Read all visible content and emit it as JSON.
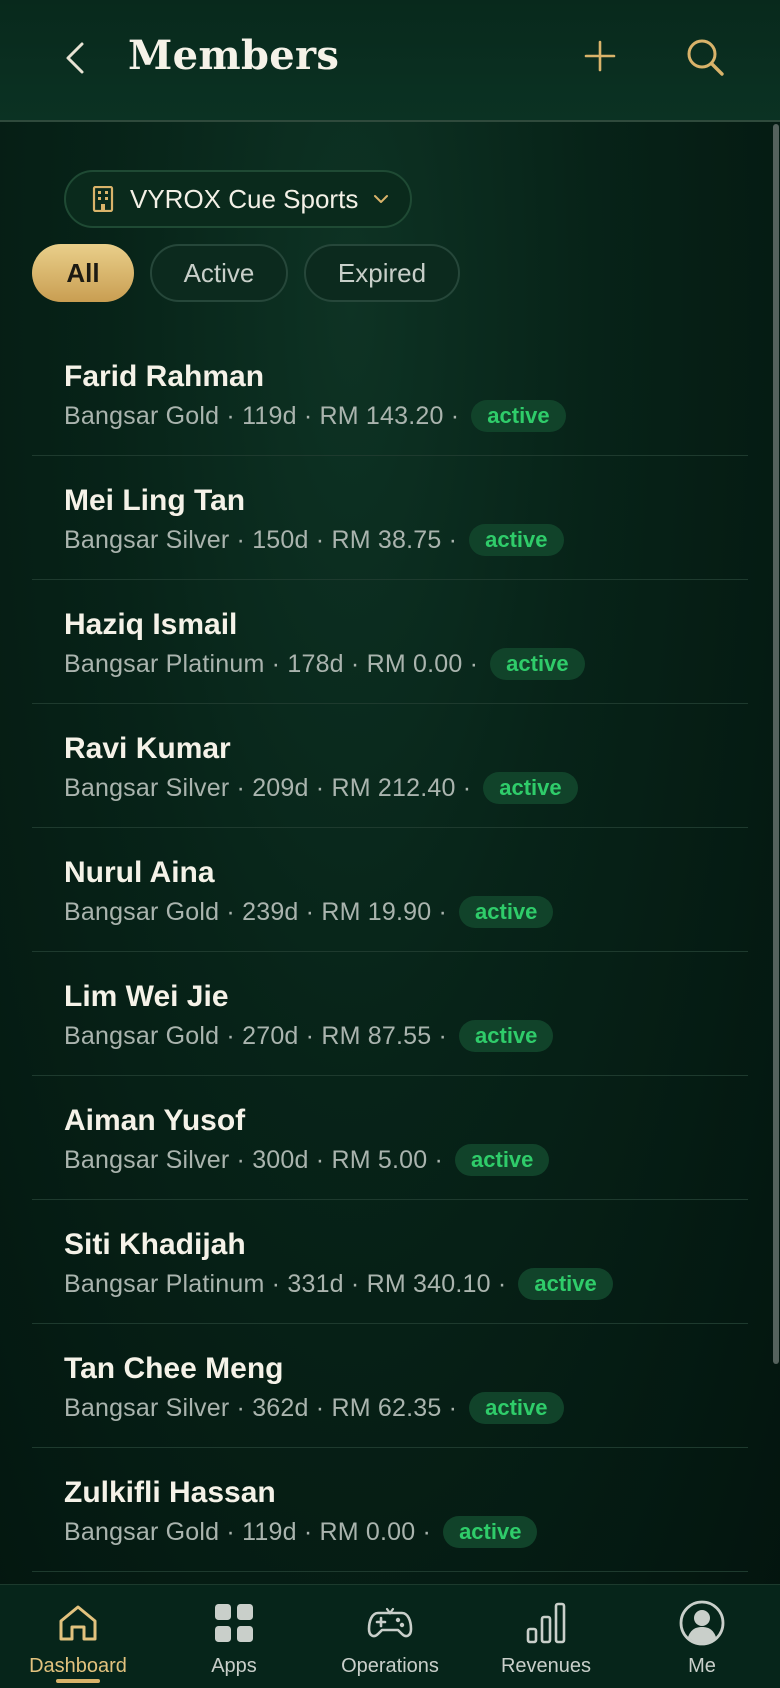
{
  "header": {
    "title": "Members",
    "back_icon": "chevron-left-icon",
    "add_icon": "plus-icon",
    "search_icon": "search-icon"
  },
  "venue": {
    "icon": "building-icon",
    "label": "VYROX Cue Sports",
    "chevron_icon": "chevron-down-icon"
  },
  "filters": [
    {
      "label": "All",
      "selected": true
    },
    {
      "label": "Active",
      "selected": false
    },
    {
      "label": "Expired",
      "selected": false
    }
  ],
  "members": [
    {
      "name": "Farid Rahman",
      "plan": "Bangsar Gold",
      "days": "119d",
      "balance": "RM 143.20",
      "status": "active"
    },
    {
      "name": "Mei Ling Tan",
      "plan": "Bangsar Silver",
      "days": "150d",
      "balance": "RM 38.75",
      "status": "active"
    },
    {
      "name": "Haziq Ismail",
      "plan": "Bangsar Platinum",
      "days": "178d",
      "balance": "RM 0.00",
      "status": "active"
    },
    {
      "name": "Ravi Kumar",
      "plan": "Bangsar Silver",
      "days": "209d",
      "balance": "RM 212.40",
      "status": "active"
    },
    {
      "name": "Nurul Aina",
      "plan": "Bangsar Gold",
      "days": "239d",
      "balance": "RM 19.90",
      "status": "active"
    },
    {
      "name": "Lim Wei Jie",
      "plan": "Bangsar Gold",
      "days": "270d",
      "balance": "RM 87.55",
      "status": "active"
    },
    {
      "name": "Aiman Yusof",
      "plan": "Bangsar Silver",
      "days": "300d",
      "balance": "RM 5.00",
      "status": "active"
    },
    {
      "name": "Siti Khadijah",
      "plan": "Bangsar Platinum",
      "days": "331d",
      "balance": "RM 340.10",
      "status": "active"
    },
    {
      "name": "Tan Chee Meng",
      "plan": "Bangsar Silver",
      "days": "362d",
      "balance": "RM 62.35",
      "status": "active"
    },
    {
      "name": "Zulkifli Hassan",
      "plan": "Bangsar Gold",
      "days": "119d",
      "balance": "RM 0.00",
      "status": "active"
    }
  ],
  "nav": [
    {
      "label": "Dashboard",
      "icon": "home-icon",
      "active": true
    },
    {
      "label": "Apps",
      "icon": "apps-grid-icon",
      "active": false
    },
    {
      "label": "Operations",
      "icon": "gamepad-icon",
      "active": false
    },
    {
      "label": "Revenues",
      "icon": "bar-chart-icon",
      "active": false
    },
    {
      "label": "Me",
      "icon": "user-avatar-icon",
      "active": false
    }
  ],
  "colors": {
    "accent_gold": "#d9b36a",
    "status_green": "#2fcc6a",
    "background": "#072318"
  }
}
